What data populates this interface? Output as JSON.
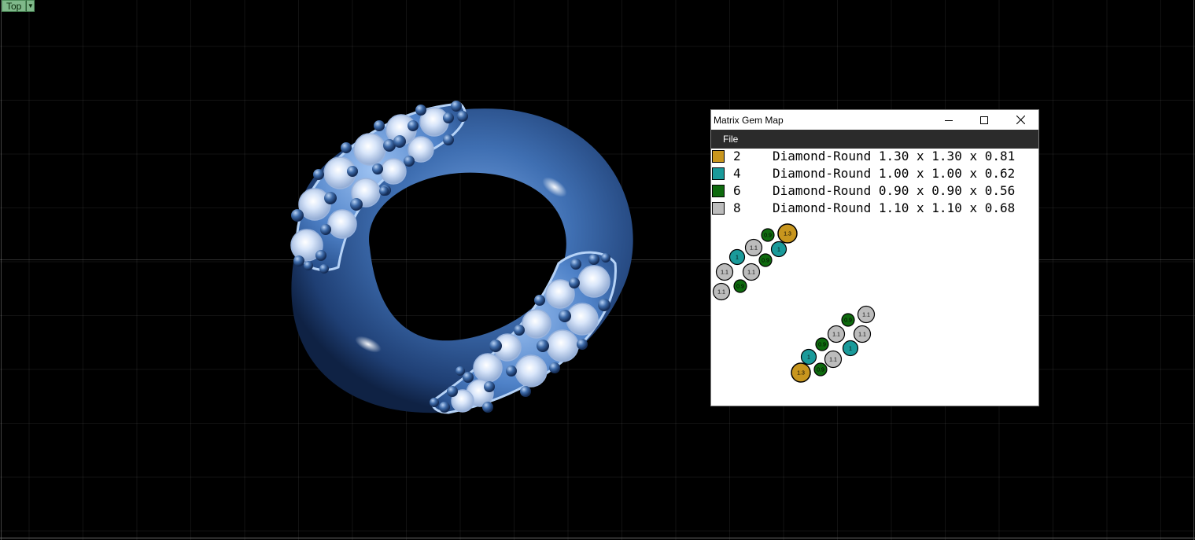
{
  "viewport": {
    "label": "Top",
    "background": "#000000"
  },
  "ring": {
    "color": "#4a78b8"
  },
  "gem_window": {
    "title": "Matrix Gem Map",
    "menu": [
      "File"
    ],
    "legend": [
      {
        "count": "2",
        "description": "Diamond-Round 1.30 x 1.30 x 0.81",
        "color": "#c8961e",
        "label": "1.3"
      },
      {
        "count": "4",
        "description": "Diamond-Round 1.00 x 1.00 x 0.62",
        "color": "#1a9a9a",
        "label": "1"
      },
      {
        "count": "6",
        "description": "Diamond-Round 0.90 x 0.90 x 0.56",
        "color": "#0e6a0e",
        "label": "0.9"
      },
      {
        "count": "8",
        "description": "Diamond-Round 1.10 x 1.10 x 0.68",
        "color": "#bcbcbc",
        "label": "1.1"
      }
    ],
    "map_labels": {
      "gem_1_3": "1.3",
      "gem_1": "1",
      "gem_0_9": "0.9",
      "gem_1_1": "1.1"
    }
  }
}
